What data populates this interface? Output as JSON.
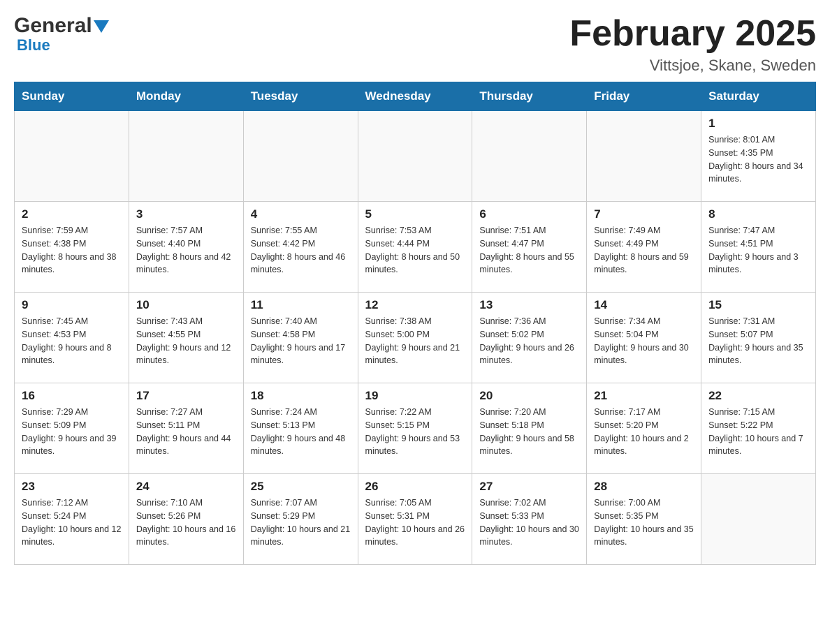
{
  "logo": {
    "general": "General",
    "blue": "Blue"
  },
  "title": "February 2025",
  "subtitle": "Vittsjoe, Skane, Sweden",
  "days_of_week": [
    "Sunday",
    "Monday",
    "Tuesday",
    "Wednesday",
    "Thursday",
    "Friday",
    "Saturday"
  ],
  "weeks": [
    [
      {
        "day": "",
        "info": ""
      },
      {
        "day": "",
        "info": ""
      },
      {
        "day": "",
        "info": ""
      },
      {
        "day": "",
        "info": ""
      },
      {
        "day": "",
        "info": ""
      },
      {
        "day": "",
        "info": ""
      },
      {
        "day": "1",
        "info": "Sunrise: 8:01 AM\nSunset: 4:35 PM\nDaylight: 8 hours and 34 minutes."
      }
    ],
    [
      {
        "day": "2",
        "info": "Sunrise: 7:59 AM\nSunset: 4:38 PM\nDaylight: 8 hours and 38 minutes."
      },
      {
        "day": "3",
        "info": "Sunrise: 7:57 AM\nSunset: 4:40 PM\nDaylight: 8 hours and 42 minutes."
      },
      {
        "day": "4",
        "info": "Sunrise: 7:55 AM\nSunset: 4:42 PM\nDaylight: 8 hours and 46 minutes."
      },
      {
        "day": "5",
        "info": "Sunrise: 7:53 AM\nSunset: 4:44 PM\nDaylight: 8 hours and 50 minutes."
      },
      {
        "day": "6",
        "info": "Sunrise: 7:51 AM\nSunset: 4:47 PM\nDaylight: 8 hours and 55 minutes."
      },
      {
        "day": "7",
        "info": "Sunrise: 7:49 AM\nSunset: 4:49 PM\nDaylight: 8 hours and 59 minutes."
      },
      {
        "day": "8",
        "info": "Sunrise: 7:47 AM\nSunset: 4:51 PM\nDaylight: 9 hours and 3 minutes."
      }
    ],
    [
      {
        "day": "9",
        "info": "Sunrise: 7:45 AM\nSunset: 4:53 PM\nDaylight: 9 hours and 8 minutes."
      },
      {
        "day": "10",
        "info": "Sunrise: 7:43 AM\nSunset: 4:55 PM\nDaylight: 9 hours and 12 minutes."
      },
      {
        "day": "11",
        "info": "Sunrise: 7:40 AM\nSunset: 4:58 PM\nDaylight: 9 hours and 17 minutes."
      },
      {
        "day": "12",
        "info": "Sunrise: 7:38 AM\nSunset: 5:00 PM\nDaylight: 9 hours and 21 minutes."
      },
      {
        "day": "13",
        "info": "Sunrise: 7:36 AM\nSunset: 5:02 PM\nDaylight: 9 hours and 26 minutes."
      },
      {
        "day": "14",
        "info": "Sunrise: 7:34 AM\nSunset: 5:04 PM\nDaylight: 9 hours and 30 minutes."
      },
      {
        "day": "15",
        "info": "Sunrise: 7:31 AM\nSunset: 5:07 PM\nDaylight: 9 hours and 35 minutes."
      }
    ],
    [
      {
        "day": "16",
        "info": "Sunrise: 7:29 AM\nSunset: 5:09 PM\nDaylight: 9 hours and 39 minutes."
      },
      {
        "day": "17",
        "info": "Sunrise: 7:27 AM\nSunset: 5:11 PM\nDaylight: 9 hours and 44 minutes."
      },
      {
        "day": "18",
        "info": "Sunrise: 7:24 AM\nSunset: 5:13 PM\nDaylight: 9 hours and 48 minutes."
      },
      {
        "day": "19",
        "info": "Sunrise: 7:22 AM\nSunset: 5:15 PM\nDaylight: 9 hours and 53 minutes."
      },
      {
        "day": "20",
        "info": "Sunrise: 7:20 AM\nSunset: 5:18 PM\nDaylight: 9 hours and 58 minutes."
      },
      {
        "day": "21",
        "info": "Sunrise: 7:17 AM\nSunset: 5:20 PM\nDaylight: 10 hours and 2 minutes."
      },
      {
        "day": "22",
        "info": "Sunrise: 7:15 AM\nSunset: 5:22 PM\nDaylight: 10 hours and 7 minutes."
      }
    ],
    [
      {
        "day": "23",
        "info": "Sunrise: 7:12 AM\nSunset: 5:24 PM\nDaylight: 10 hours and 12 minutes."
      },
      {
        "day": "24",
        "info": "Sunrise: 7:10 AM\nSunset: 5:26 PM\nDaylight: 10 hours and 16 minutes."
      },
      {
        "day": "25",
        "info": "Sunrise: 7:07 AM\nSunset: 5:29 PM\nDaylight: 10 hours and 21 minutes."
      },
      {
        "day": "26",
        "info": "Sunrise: 7:05 AM\nSunset: 5:31 PM\nDaylight: 10 hours and 26 minutes."
      },
      {
        "day": "27",
        "info": "Sunrise: 7:02 AM\nSunset: 5:33 PM\nDaylight: 10 hours and 30 minutes."
      },
      {
        "day": "28",
        "info": "Sunrise: 7:00 AM\nSunset: 5:35 PM\nDaylight: 10 hours and 35 minutes."
      },
      {
        "day": "",
        "info": ""
      }
    ]
  ]
}
